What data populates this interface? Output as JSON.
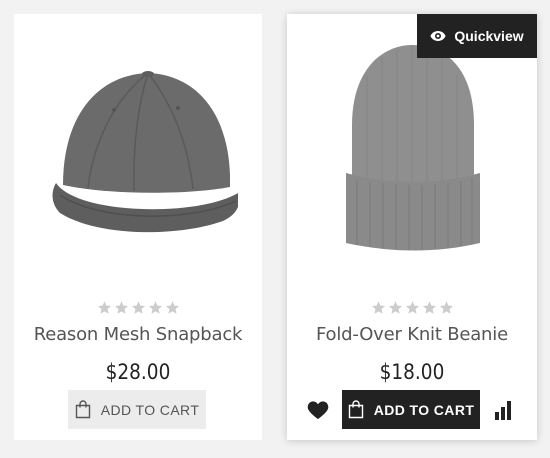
{
  "products": [
    {
      "name": "Reason Mesh Snapback",
      "price": "$28.00",
      "rating": 0,
      "rating_max": 5,
      "add_to_cart_label": "ADD TO CART",
      "image_icon": "baseball-cap-image",
      "product_color": "#666666"
    },
    {
      "name": "Fold-Over Knit Beanie",
      "price": "$18.00",
      "rating": 0,
      "rating_max": 5,
      "add_to_cart_label": "ADD TO CART",
      "image_icon": "beanie-image",
      "product_color": "#8c8c8c",
      "quickview_label": "Quickview",
      "hovered": true
    }
  ],
  "colors": {
    "accent_dark": "#222222",
    "star_empty": "#cccccc",
    "button_light": "#ececec"
  }
}
